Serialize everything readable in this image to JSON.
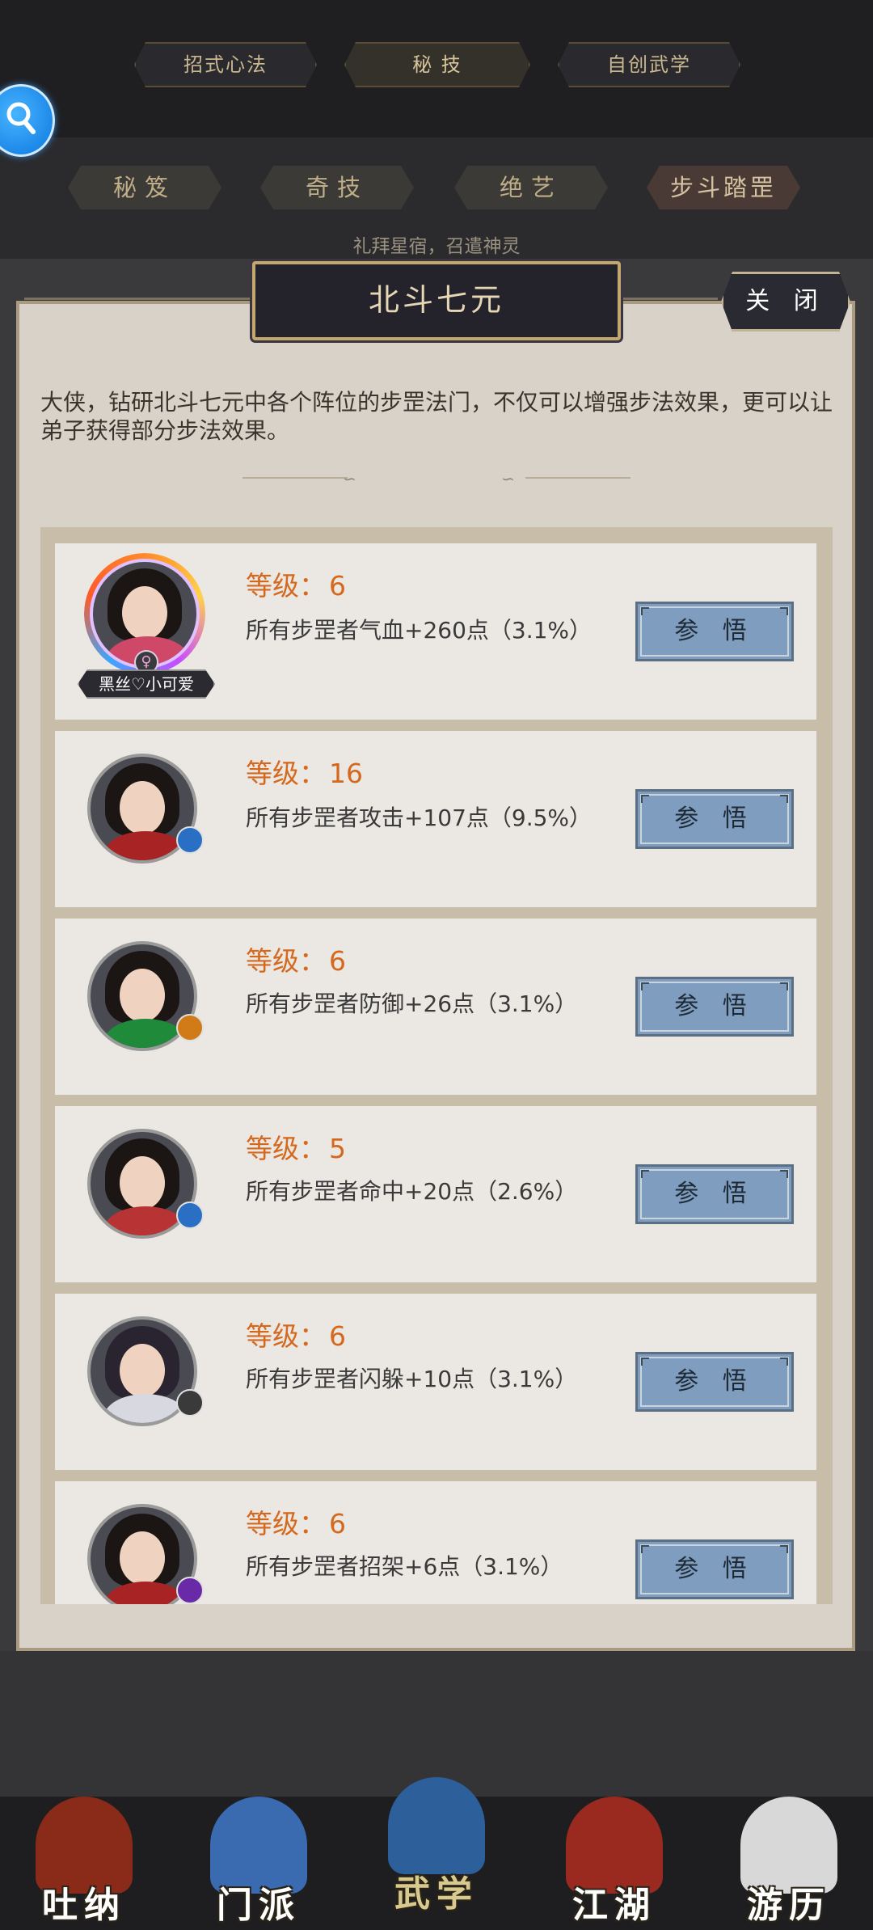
{
  "top_tabs": [
    {
      "label": "招式心法"
    },
    {
      "label": "秘 技"
    },
    {
      "label": "自创武学"
    }
  ],
  "sub_tabs": [
    {
      "label": "秘笈"
    },
    {
      "label": "奇技"
    },
    {
      "label": "绝艺"
    },
    {
      "label": "步斗踏罡"
    }
  ],
  "sub_subtitle": "礼拜星宿，召遣神灵",
  "panel": {
    "title": "北斗七元",
    "close_label": "关 闭",
    "intro": "大侠，钻研北斗七元中各个阵位的步罡法门，不仅可以增强步法效果，更可以让弟子获得部分步法效果。"
  },
  "list": {
    "level_prefix": "等级：",
    "button_label": "参 悟",
    "rows": [
      {
        "level": "6",
        "effect": "所有步罡者气血+260点（3.1%）",
        "name": "黑丝♡小可爱",
        "gender": "♀",
        "outfit_color": "#d04868",
        "badge_color": "#6a4a9a"
      },
      {
        "level": "16",
        "effect": "所有步罡者攻击+107点（9.5%）",
        "outfit_color": "#a82424",
        "badge_color": "#2a6fc4"
      },
      {
        "level": "6",
        "effect": "所有步罡者防御+26点（3.1%）",
        "outfit_color": "#1f8a3a",
        "badge_color": "#d07a18"
      },
      {
        "level": "5",
        "effect": "所有步罡者命中+20点（2.6%）",
        "outfit_color": "#b83434",
        "badge_color": "#2a6fc4"
      },
      {
        "level": "6",
        "effect": "所有步罡者闪躲+10点（3.1%）",
        "outfit_color": "#d8d8e0",
        "badge_color": "#3a3a3a"
      },
      {
        "level": "6",
        "effect": "所有步罡者招架+6点（3.1%）",
        "outfit_color": "#a82424",
        "badge_color": "#6a2aa8"
      }
    ]
  },
  "bottom_nav": [
    {
      "label": "吐纳",
      "icon": "furnace-icon",
      "color": "#8a2a18"
    },
    {
      "label": "门派",
      "icon": "sect-banner-icon",
      "color": "#3a6ab0"
    },
    {
      "label": "武学",
      "icon": "martial-book-icon",
      "color": "#2d5f9a"
    },
    {
      "label": "江湖",
      "icon": "bamboo-hat-icon",
      "color": "#9a2a20"
    },
    {
      "label": "游历",
      "icon": "white-horse-icon",
      "color": "#d8d8d8"
    }
  ]
}
